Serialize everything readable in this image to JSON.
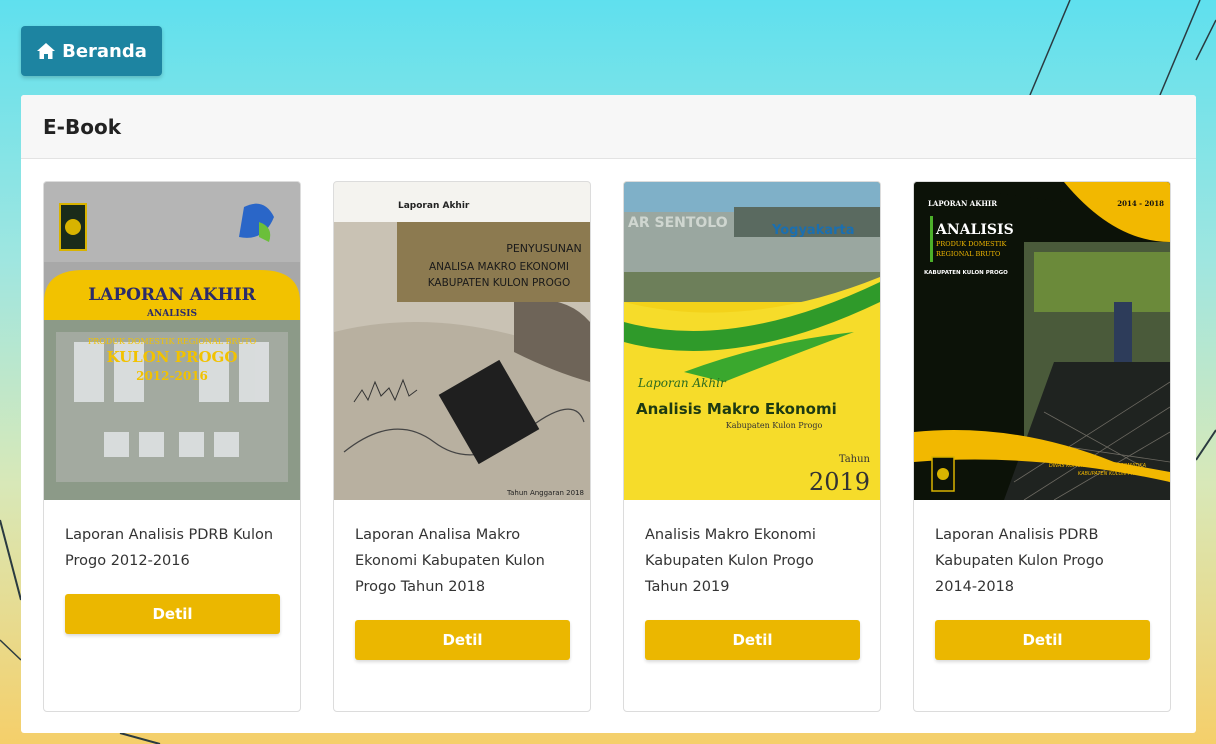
{
  "nav": {
    "home_label": "Beranda"
  },
  "panel": {
    "title": "E-Book"
  },
  "accent_colors": {
    "home_button": "#1d84a1",
    "detil_button": "#ebb700"
  },
  "books": [
    {
      "title": "Laporan Analisis PDRB Kulon Progo 2012-2016",
      "button": "Detil",
      "cover": {
        "line1": "LAPORAN AKHIR",
        "line2": "ANALISIS",
        "line3": "PRODUK DOMESTIK REGIONAL BRUTO",
        "line4": "KULON PROGO",
        "line5": "2012-2016"
      }
    },
    {
      "title": "Laporan Analisa Makro Ekonomi Kabupaten Kulon Progo Tahun 2018",
      "button": "Detil",
      "cover": {
        "top": "Laporan Akhir",
        "line1": "PENYUSUNAN",
        "line2": "ANALISA MAKRO EKONOMI",
        "line3": "KABUPATEN KULON PROGO",
        "bottom": "Tahun Anggaran 2018"
      }
    },
    {
      "title": "Analisis Makro Ekonomi Kabupaten Kulon Progo Tahun 2019",
      "button": "Detil",
      "cover": {
        "sign1": "AR SENTOLO",
        "sign2": "Yogyakarta",
        "line1": "Laporan Akhir",
        "line2": "Analisis Makro Ekonomi",
        "line3": "Kabupaten Kulon Progo",
        "year_label": "Tahun",
        "year": "2019"
      }
    },
    {
      "title": "Laporan Analisis PDRB Kabupaten Kulon Progo 2014-2018",
      "button": "Detil",
      "cover": {
        "top_left": "LAPORAN AKHIR",
        "top_right": "2014 - 2018",
        "line1": "ANALISIS",
        "line2": "PRODUK DOMESTIK",
        "line3": "REGIONAL BRUTO",
        "line4": "KABUPATEN KULON PROGO",
        "footer1": "DINAS KOMUNIKASI DAN INFORMATIKA",
        "footer2": "KABUPATEN KULON PROGO"
      }
    }
  ]
}
